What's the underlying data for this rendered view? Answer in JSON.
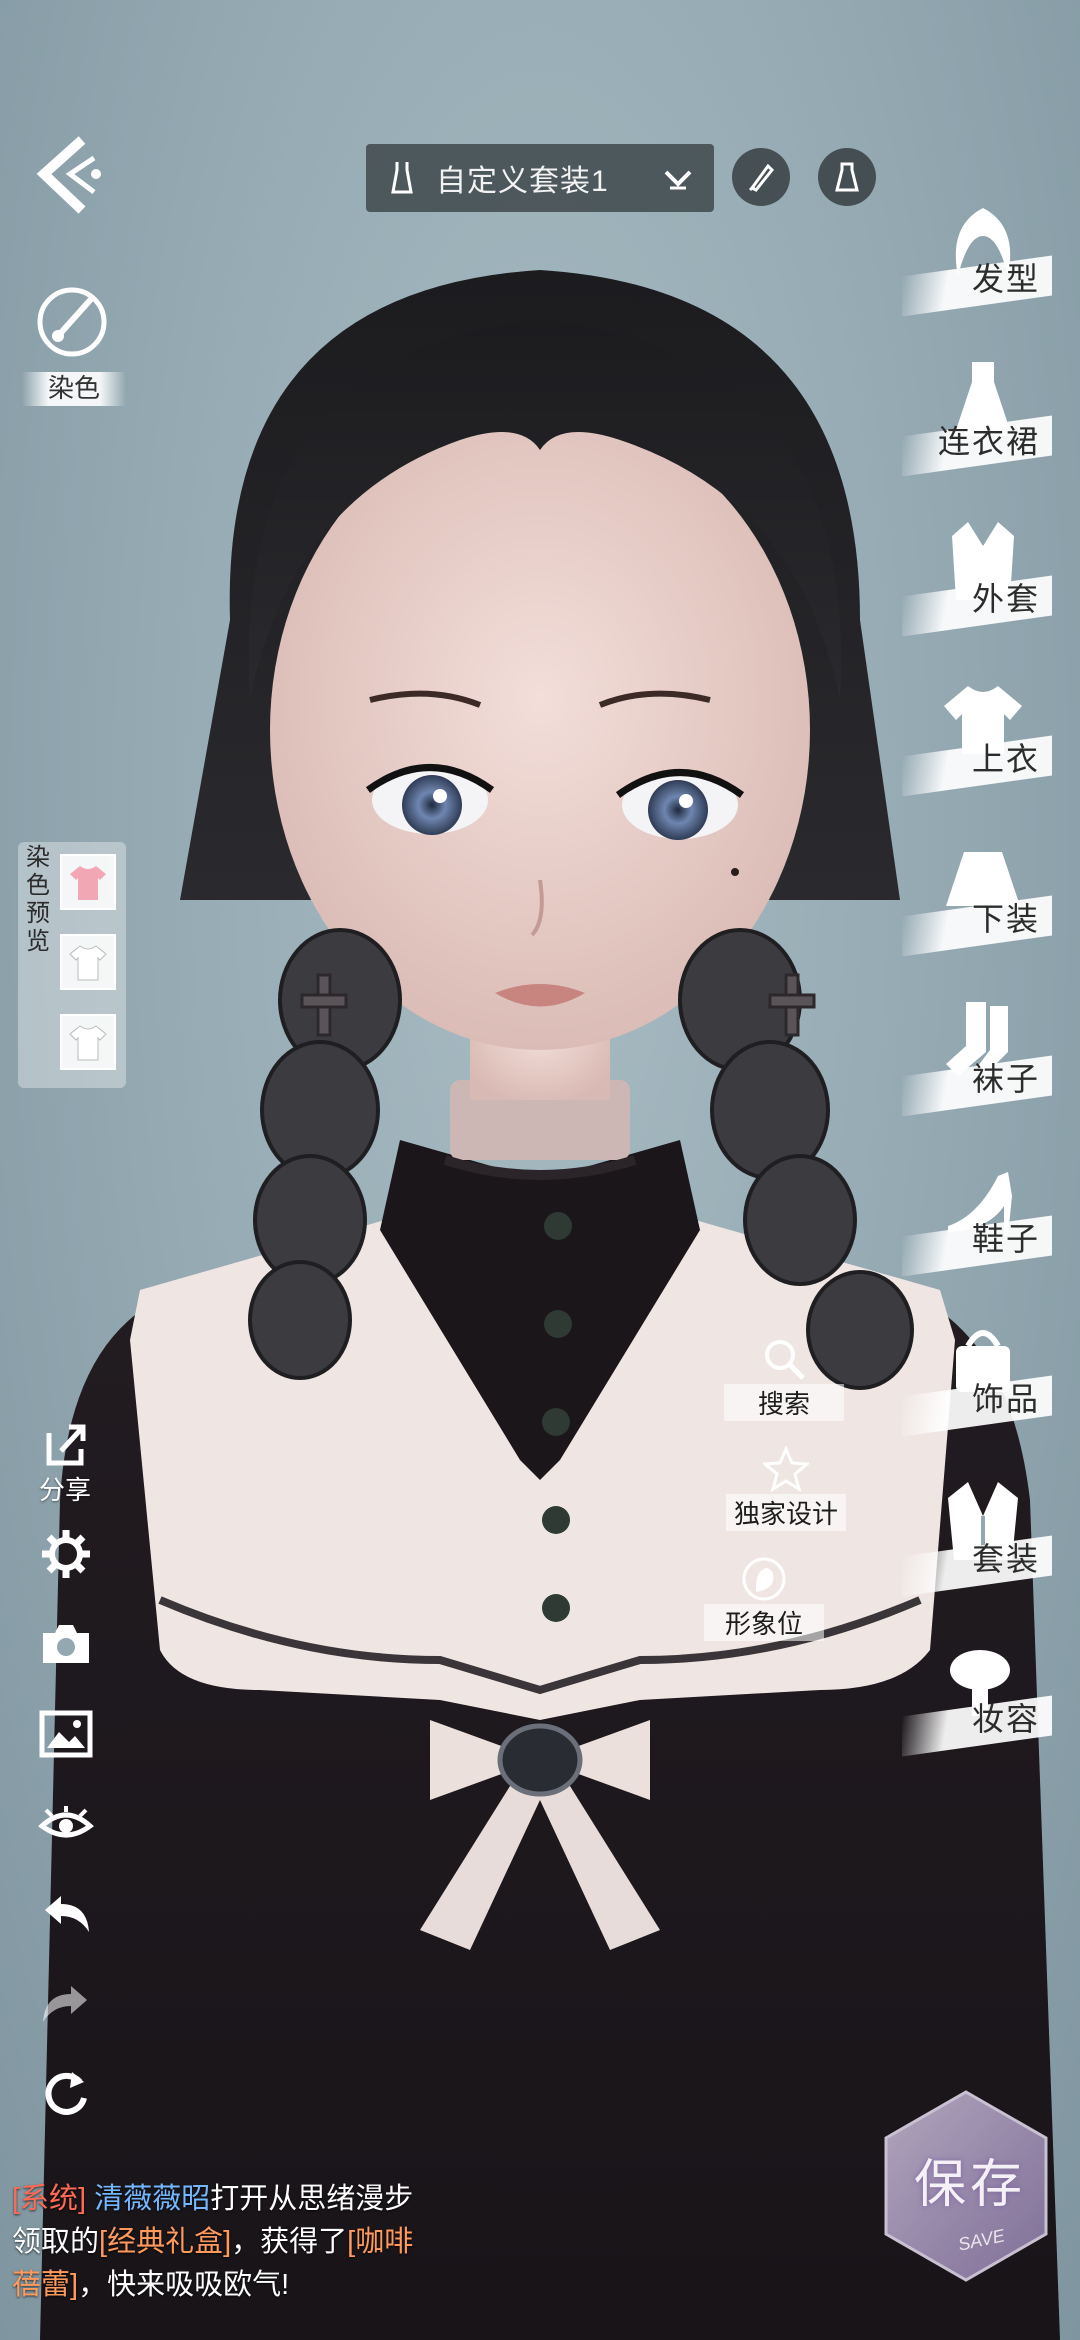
{
  "header": {
    "outfit_name": "自定义套装1"
  },
  "left": {
    "dye_label": "染色",
    "dye_preview_title": "染色预览",
    "share_label": "分享"
  },
  "categories": [
    {
      "label": "发型"
    },
    {
      "label": "连衣裙"
    },
    {
      "label": "外套"
    },
    {
      "label": "上衣"
    },
    {
      "label": "下装"
    },
    {
      "label": "袜子"
    },
    {
      "label": "鞋子"
    },
    {
      "label": "饰品"
    },
    {
      "label": "套装"
    },
    {
      "label": "妆容"
    }
  ],
  "quick_tools": {
    "search": "搜索",
    "exclusive": "独家设计",
    "image_slot": "形象位"
  },
  "chat": {
    "tag": "[系统]",
    "player": "清薇薇昭",
    "text1": "打开从思绪漫步领取的",
    "item1": "[经典礼盒]",
    "text2": "，获得了",
    "item2": "[咖啡蓓蕾]",
    "text3": "，快来吸吸欧气!"
  },
  "save": {
    "label": "保存",
    "sub": "SAVE"
  },
  "colors": {
    "background": "#93a8b1",
    "accent_pink": "#f2a7b5",
    "system_red": "#ff6a55",
    "name_blue": "#74b7ff",
    "item_orange": "#ff9a5c"
  }
}
